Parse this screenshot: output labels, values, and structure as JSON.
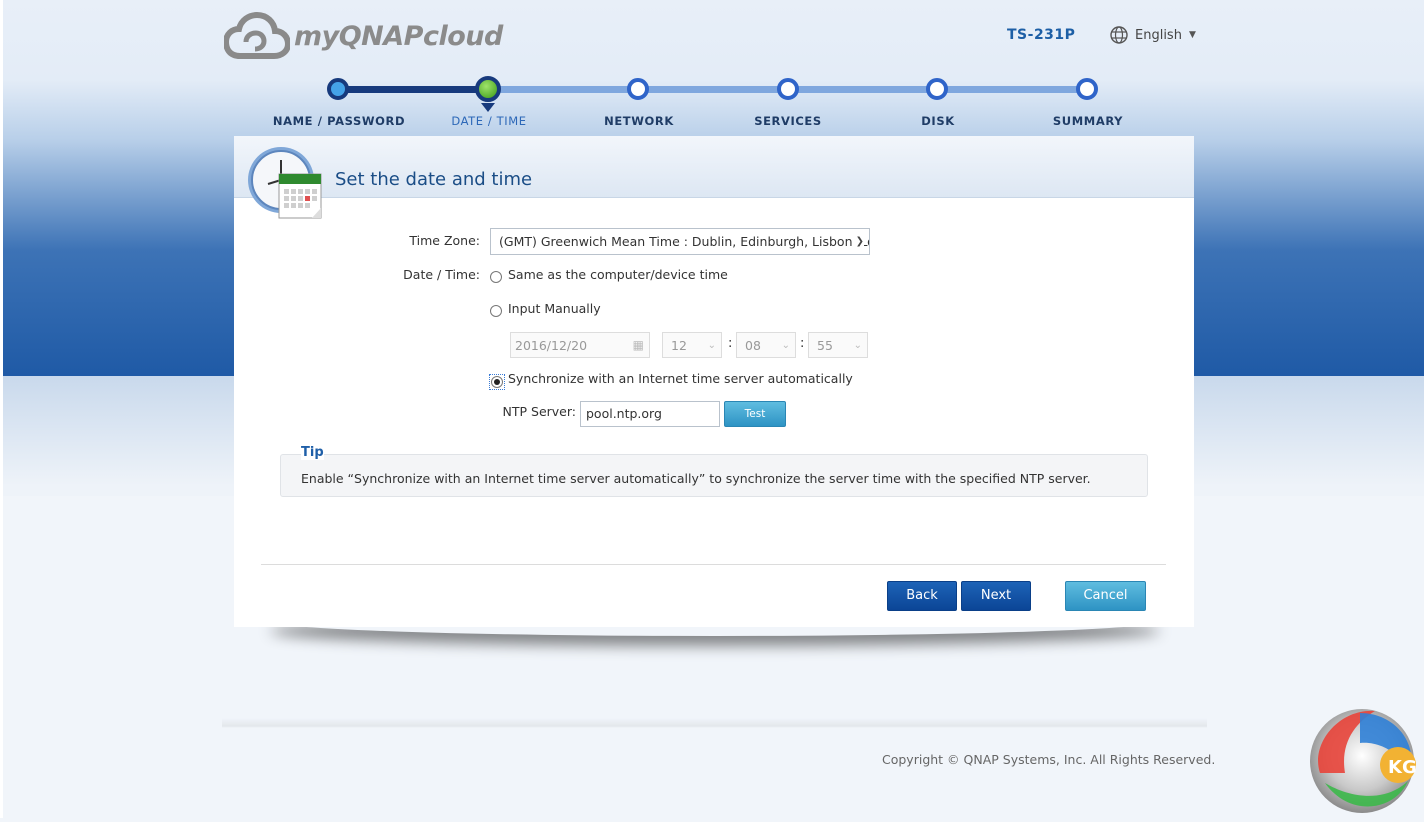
{
  "header": {
    "logo_text": "myQNAPcloud",
    "model": "TS-231P",
    "language": "English"
  },
  "steps": [
    {
      "label": "NAME / PASSWORD",
      "state": "done"
    },
    {
      "label": "DATE / TIME",
      "state": "active"
    },
    {
      "label": "NETWORK",
      "state": "todo"
    },
    {
      "label": "SERVICES",
      "state": "todo"
    },
    {
      "label": "DISK",
      "state": "todo"
    },
    {
      "label": "SUMMARY",
      "state": "todo"
    }
  ],
  "panel": {
    "title": "Set the date and time"
  },
  "form": {
    "timezone_label": "Time Zone:",
    "timezone_value": "(GMT) Greenwich Mean Time : Dublin, Edinburgh, Lisbon, London",
    "datetime_label": "Date / Time:",
    "option_same": "Same as the computer/device time",
    "option_manual": "Input Manually",
    "manual_date": "2016/12/20",
    "manual_hour": "12",
    "manual_minute": "08",
    "manual_second": "55",
    "option_sync": "Synchronize with an Internet time server automatically",
    "selected_option": "sync",
    "ntp_label": "NTP Server:",
    "ntp_value": "pool.ntp.org",
    "test_label": "Test"
  },
  "tip": {
    "title": "Tip",
    "text": "Enable “Synchronize with an Internet time server automatically” to synchronize the server time with the specified NTP server."
  },
  "buttons": {
    "back": "Back",
    "next": "Next",
    "cancel": "Cancel"
  },
  "footer": {
    "copyright": "Copyright © QNAP Systems, Inc. All Rights Reserved."
  },
  "colors": {
    "primary_dark": "#173a7d",
    "accent_blue": "#1d63b7",
    "accent_teal": "#3aa3d0",
    "active_step": "#45b81f"
  },
  "icons": [
    "cloud-logo-icon",
    "globe-icon",
    "clock-calendar-icon",
    "calendar-icon",
    "chevron-down-icon",
    "watermark-logo"
  ]
}
